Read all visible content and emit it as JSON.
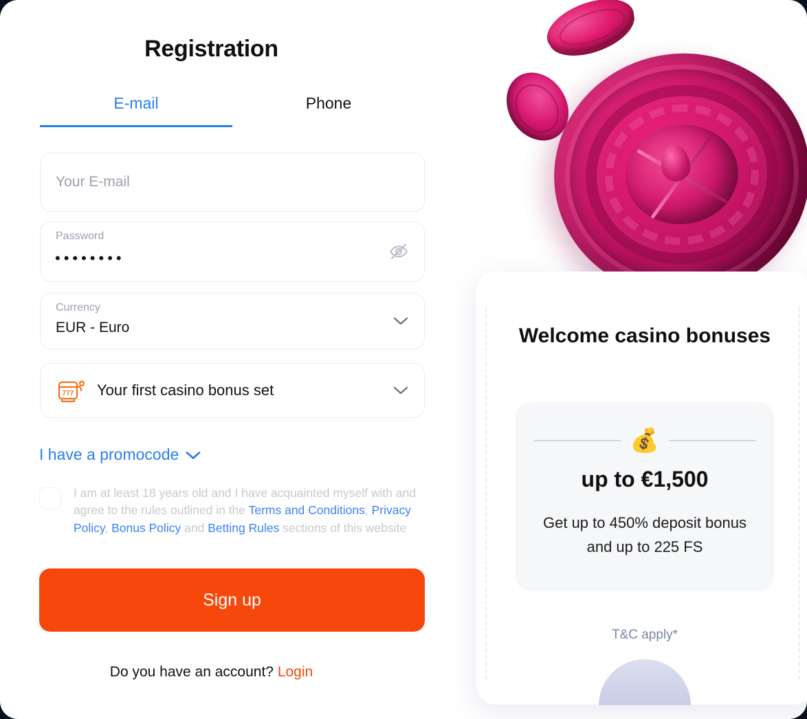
{
  "page": {
    "title": "Registration"
  },
  "tabs": [
    {
      "label": "E-mail",
      "active": true
    },
    {
      "label": "Phone",
      "active": false
    }
  ],
  "form": {
    "email": {
      "placeholder": "Your E-mail",
      "value": ""
    },
    "password": {
      "label": "Password",
      "value": "••••••••",
      "toggle_icon": "eye-off-icon"
    },
    "currency": {
      "label": "Currency",
      "value": "EUR - Euro",
      "chevron": "chevron-down-icon"
    },
    "bonus": {
      "icon": "slot-machine-777-icon",
      "value": "Your first casino bonus set",
      "chevron": "chevron-down-icon"
    },
    "promocode": {
      "label": "I have a promocode",
      "chevron": "chevron-down-icon"
    },
    "terms": {
      "checked": false,
      "part1": "I am at least 18 years old and I have acquainted myself with and agree to the rules outlined in the ",
      "link1": "Terms and Conditions",
      "sep1": ", ",
      "link2": "Privacy Policy",
      "sep2": ", ",
      "link3": "Bonus Policy",
      "sep3": " and ",
      "link4": "Betting Rules",
      "part2": " sections of this website"
    },
    "submit_label": "Sign up",
    "footer": {
      "question": "Do you have an account?",
      "login_label": "Login"
    }
  },
  "bonus_card": {
    "title": "Welcome casino bonuses",
    "icon": "money-bag-emoji",
    "amount": "up to €1,500",
    "description": "Get up to 450% deposit bonus and up to 225 FS",
    "terms_note": "T&C apply*"
  },
  "colors": {
    "accent_blue": "#2b7cf0",
    "accent_orange": "#f6480b",
    "link_blue": "#3b82f6",
    "muted": "#c6c9d2",
    "card_bg": "#f6f7f9",
    "wheel_magenta": "#d51a6f"
  }
}
